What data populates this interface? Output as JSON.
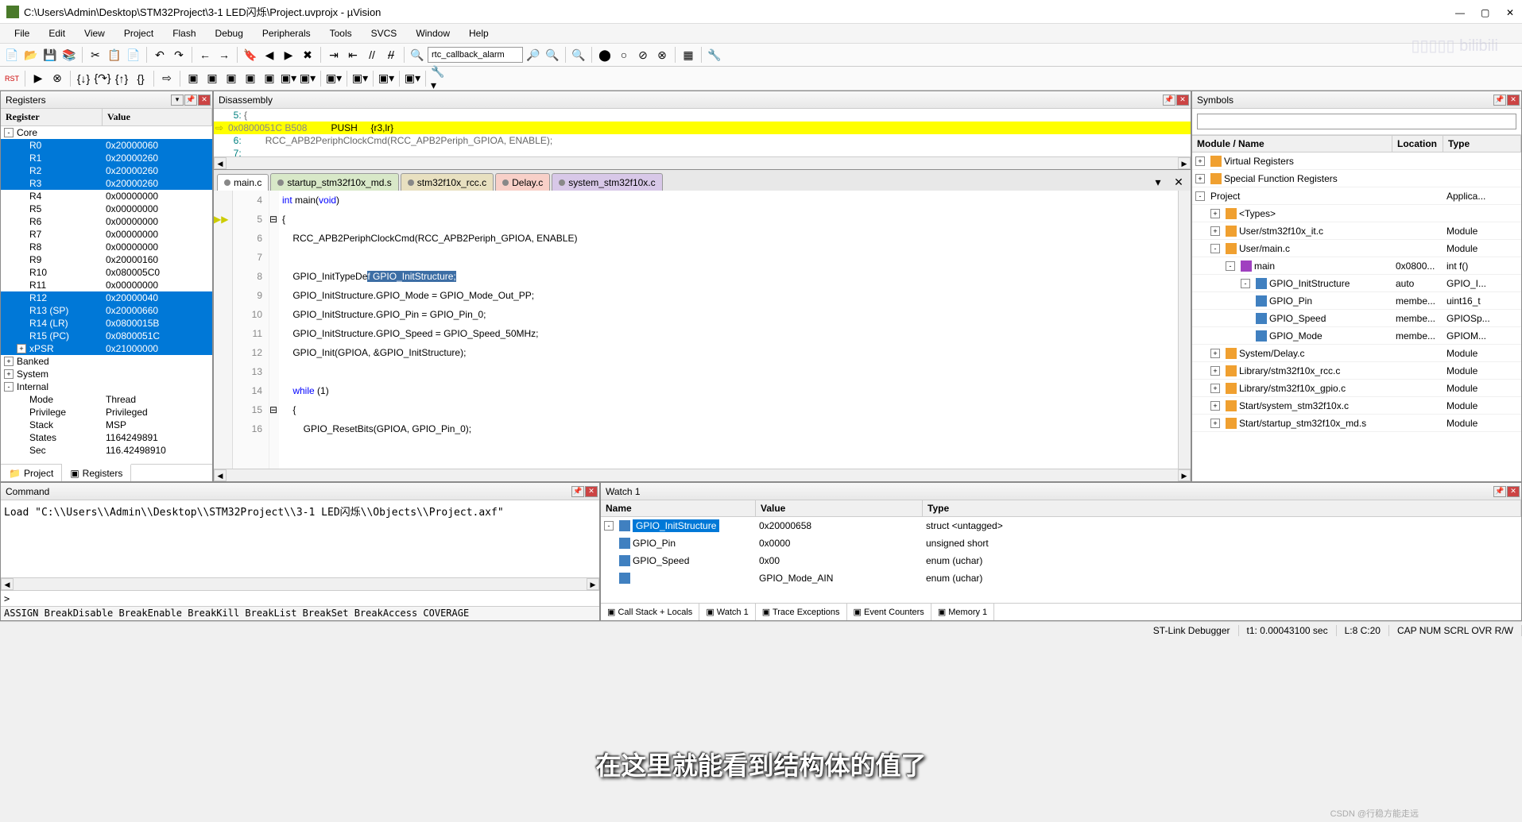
{
  "title": "C:\\Users\\Admin\\Desktop\\STM32Project\\3-1 LED闪烁\\Project.uvprojx - µVision",
  "menu": [
    "File",
    "Edit",
    "View",
    "Project",
    "Flash",
    "Debug",
    "Peripherals",
    "Tools",
    "SVCS",
    "Window",
    "Help"
  ],
  "toolbar_combo": "rtc_callback_alarm",
  "panels": {
    "registers": "Registers",
    "disassembly": "Disassembly",
    "symbols": "Symbols",
    "command": "Command",
    "watch": "Watch 1"
  },
  "reg_hdr": {
    "c1": "Register",
    "c2": "Value"
  },
  "registers": [
    {
      "name": "Core",
      "exp": "-",
      "lvl": 0
    },
    {
      "name": "R0",
      "val": "0x20000060",
      "lvl": 1,
      "sel": true
    },
    {
      "name": "R1",
      "val": "0x20000260",
      "lvl": 1,
      "sel": true
    },
    {
      "name": "R2",
      "val": "0x20000260",
      "lvl": 1,
      "sel": true
    },
    {
      "name": "R3",
      "val": "0x20000260",
      "lvl": 1,
      "sel": true
    },
    {
      "name": "R4",
      "val": "0x00000000",
      "lvl": 1
    },
    {
      "name": "R5",
      "val": "0x00000000",
      "lvl": 1
    },
    {
      "name": "R6",
      "val": "0x00000000",
      "lvl": 1
    },
    {
      "name": "R7",
      "val": "0x00000000",
      "lvl": 1
    },
    {
      "name": "R8",
      "val": "0x00000000",
      "lvl": 1
    },
    {
      "name": "R9",
      "val": "0x20000160",
      "lvl": 1
    },
    {
      "name": "R10",
      "val": "0x080005C0",
      "lvl": 1
    },
    {
      "name": "R11",
      "val": "0x00000000",
      "lvl": 1
    },
    {
      "name": "R12",
      "val": "0x20000040",
      "lvl": 1,
      "sel": true
    },
    {
      "name": "R13 (SP)",
      "val": "0x20000660",
      "lvl": 1,
      "sel": true
    },
    {
      "name": "R14 (LR)",
      "val": "0x0800015B",
      "lvl": 1,
      "sel": true
    },
    {
      "name": "R15 (PC)",
      "val": "0x0800051C",
      "lvl": 1,
      "sel": true
    },
    {
      "name": "xPSR",
      "val": "0x21000000",
      "lvl": 1,
      "sel": true,
      "exp": "+"
    },
    {
      "name": "Banked",
      "lvl": 0,
      "exp": "+"
    },
    {
      "name": "System",
      "lvl": 0,
      "exp": "+"
    },
    {
      "name": "Internal",
      "lvl": 0,
      "exp": "-"
    },
    {
      "name": "Mode",
      "val": "Thread",
      "lvl": 1
    },
    {
      "name": "Privilege",
      "val": "Privileged",
      "lvl": 1
    },
    {
      "name": "Stack",
      "val": "MSP",
      "lvl": 1
    },
    {
      "name": "States",
      "val": "1164249891",
      "lvl": 1
    },
    {
      "name": "Sec",
      "val": "116.42498910",
      "lvl": 1
    }
  ],
  "reg_tabs": [
    "Project",
    "Registers"
  ],
  "disasm": [
    {
      "n": "     5:",
      "t": " {"
    },
    {
      "addr": "0x0800051C",
      "op": "B508",
      "mn": "PUSH",
      "args": "{r3,lr}",
      "hl": true
    },
    {
      "n": "     6:",
      "t": "         RCC_APB2PeriphClockCmd(RCC_APB2Periph_GPIOA, ENABLE);"
    },
    {
      "n": "     7:",
      "t": ""
    }
  ],
  "editor_tabs": [
    {
      "label": "main.c",
      "active": true
    },
    {
      "label": "startup_stm32f10x_md.s"
    },
    {
      "label": "stm32f10x_rcc.c"
    },
    {
      "label": "Delay.c"
    },
    {
      "label": "system_stm32f10x.c"
    }
  ],
  "code": [
    {
      "n": 4,
      "t": "int main(void)"
    },
    {
      "n": 5,
      "t": "{",
      "arrow": true
    },
    {
      "n": 6,
      "t": "    RCC_APB2PeriphClockCmd(RCC_APB2Periph_GPIOA, ENABLE)"
    },
    {
      "n": 7,
      "t": ""
    },
    {
      "n": 8,
      "t": "    GPIO_InitTypeDef GPIO_InitStructure;",
      "sel": [
        20,
        40
      ]
    },
    {
      "n": 9,
      "t": "    GPIO_InitStructure.GPIO_Mode = GPIO_Mode_Out_PP;"
    },
    {
      "n": 10,
      "t": "    GPIO_InitStructure.GPIO_Pin = GPIO_Pin_0;"
    },
    {
      "n": 11,
      "t": "    GPIO_InitStructure.GPIO_Speed = GPIO_Speed_50MHz;"
    },
    {
      "n": 12,
      "t": "    GPIO_Init(GPIOA, &GPIO_InitStructure);"
    },
    {
      "n": 13,
      "t": ""
    },
    {
      "n": 14,
      "t": "    while (1)"
    },
    {
      "n": 15,
      "t": "    {"
    },
    {
      "n": 16,
      "t": "        GPIO_ResetBits(GPIOA, GPIO_Pin_0);"
    }
  ],
  "sym_hdr": {
    "c1": "Module / Name",
    "c2": "Location",
    "c3": "Type"
  },
  "symbols": [
    {
      "name": "Virtual Registers",
      "lvl": 0,
      "exp": "+",
      "ico": "mod"
    },
    {
      "name": "Special Function Registers",
      "lvl": 0,
      "exp": "+",
      "ico": "mod"
    },
    {
      "name": "Project",
      "lvl": 0,
      "exp": "-",
      "loc": "",
      "type": "Applica..."
    },
    {
      "name": "<Types>",
      "lvl": 1,
      "exp": "+",
      "ico": "mod"
    },
    {
      "name": "User/stm32f10x_it.c",
      "lvl": 1,
      "exp": "+",
      "ico": "mod",
      "type": "Module"
    },
    {
      "name": "User/main.c",
      "lvl": 1,
      "exp": "-",
      "ico": "mod",
      "type": "Module"
    },
    {
      "name": "main",
      "lvl": 2,
      "exp": "-",
      "ico": "fn",
      "loc": "0x0800...",
      "type": "int f()"
    },
    {
      "name": "GPIO_InitStructure",
      "lvl": 3,
      "exp": "-",
      "ico": "var",
      "loc": "auto",
      "type": "GPIO_I..."
    },
    {
      "name": "GPIO_Pin",
      "lvl": 4,
      "ico": "var",
      "loc": "membe...",
      "type": "uint16_t"
    },
    {
      "name": "GPIO_Speed",
      "lvl": 4,
      "ico": "var",
      "loc": "membe...",
      "type": "GPIOSp..."
    },
    {
      "name": "GPIO_Mode",
      "lvl": 4,
      "ico": "var",
      "loc": "membe...",
      "type": "GPIOM..."
    },
    {
      "name": "System/Delay.c",
      "lvl": 1,
      "exp": "+",
      "ico": "mod",
      "type": "Module"
    },
    {
      "name": "Library/stm32f10x_rcc.c",
      "lvl": 1,
      "exp": "+",
      "ico": "mod",
      "type": "Module"
    },
    {
      "name": "Library/stm32f10x_gpio.c",
      "lvl": 1,
      "exp": "+",
      "ico": "mod",
      "type": "Module"
    },
    {
      "name": "Start/system_stm32f10x.c",
      "lvl": 1,
      "exp": "+",
      "ico": "mod",
      "type": "Module"
    },
    {
      "name": "Start/startup_stm32f10x_md.s",
      "lvl": 1,
      "exp": "+",
      "ico": "mod",
      "type": "Module"
    }
  ],
  "cmd_text": "Load \"C:\\\\Users\\\\Admin\\\\Desktop\\\\STM32Project\\\\3-1 LED闪烁\\\\Objects\\\\Project.axf\"",
  "cmd_prompt": ">",
  "cmd_hints": "ASSIGN BreakDisable BreakEnable BreakKill BreakList BreakSet BreakAccess COVERAGE",
  "watch_hdr": {
    "c1": "Name",
    "c2": "Value",
    "c3": "Type"
  },
  "watch": [
    {
      "name": "GPIO_InitStructure",
      "val": "0x20000658",
      "type": "struct <untagged>",
      "lvl": 0,
      "exp": "-",
      "sel": true
    },
    {
      "name": "GPIO_Pin",
      "val": "0x0000",
      "type": "unsigned short",
      "lvl": 1
    },
    {
      "name": "GPIO_Speed",
      "val": "0x00",
      "type": "enum (uchar)",
      "lvl": 1
    },
    {
      "name": "",
      "val": "GPIO_Mode_AIN",
      "type": "enum (uchar)",
      "lvl": 1
    }
  ],
  "watch_tabs": [
    "Call Stack + Locals",
    "Watch 1",
    "Trace Exceptions",
    "Event Counters",
    "Memory 1"
  ],
  "status": {
    "debugger": "ST-Link Debugger",
    "t1": "t1: 0.00043100 sec",
    "pos": "L:8 C:20",
    "caps": "CAP NUM SCRL OVR R/W"
  },
  "subtitle": "在这里就能看到结构体的值了",
  "csdn": "CSDN @行稳方能走远"
}
